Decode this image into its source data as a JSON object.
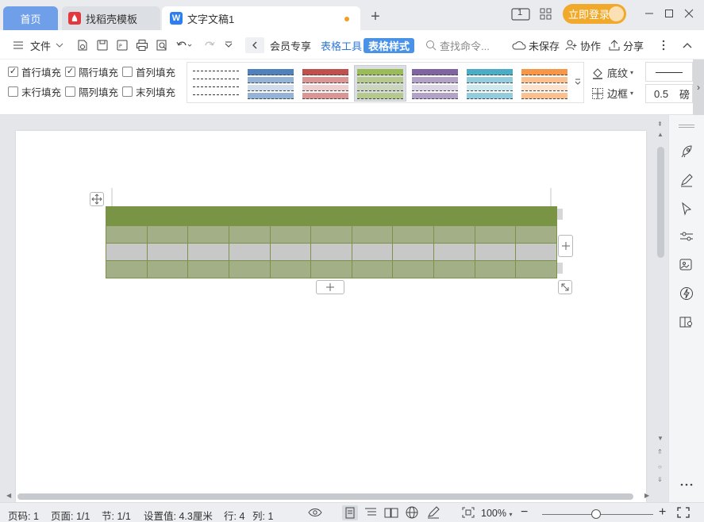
{
  "tabs": {
    "home": "首页",
    "templates": "找稻壳模板",
    "document": "文字文稿1"
  },
  "titlebar": {
    "page_indicator": "1",
    "login_label": "立即登录"
  },
  "toolbar": {
    "file_label": "文件",
    "member_label": "会员专享",
    "table_tools_label": "表格工具",
    "table_style_label": "表格样式",
    "search_placeholder": "查找命令...",
    "unsaved_label": "未保存",
    "collaborate_label": "协作",
    "share_label": "分享"
  },
  "ribbon": {
    "checks": [
      {
        "label": "首行填充",
        "checked": true
      },
      {
        "label": "隔行填充",
        "checked": true
      },
      {
        "label": "首列填充",
        "checked": false
      },
      {
        "label": "末行填充",
        "checked": false
      },
      {
        "label": "隔列填充",
        "checked": false
      },
      {
        "label": "末列填充",
        "checked": false
      }
    ],
    "style_colors": [
      "#ffffff",
      "#4f81bd",
      "#c0504d",
      "#9bbb59",
      "#8064a2",
      "#4bacc6",
      "#f79646"
    ],
    "selected_style_index": 3,
    "shading_label": "底纹",
    "border_label": "边框",
    "line_width": "0.5",
    "unit_label": "磅"
  },
  "table": {
    "columns": 11,
    "rows": 4,
    "header_color": "#7a9445",
    "odd_row_color": "#a3b087",
    "even_row_color": "#c8c8c8"
  },
  "status": {
    "page": "页码: 1",
    "pages": "页面: 1/1",
    "section": "节: 1/1",
    "setting": "设置值: 4.3厘米",
    "row": "行: 4",
    "col": "列: 1",
    "zoom": "100%"
  }
}
